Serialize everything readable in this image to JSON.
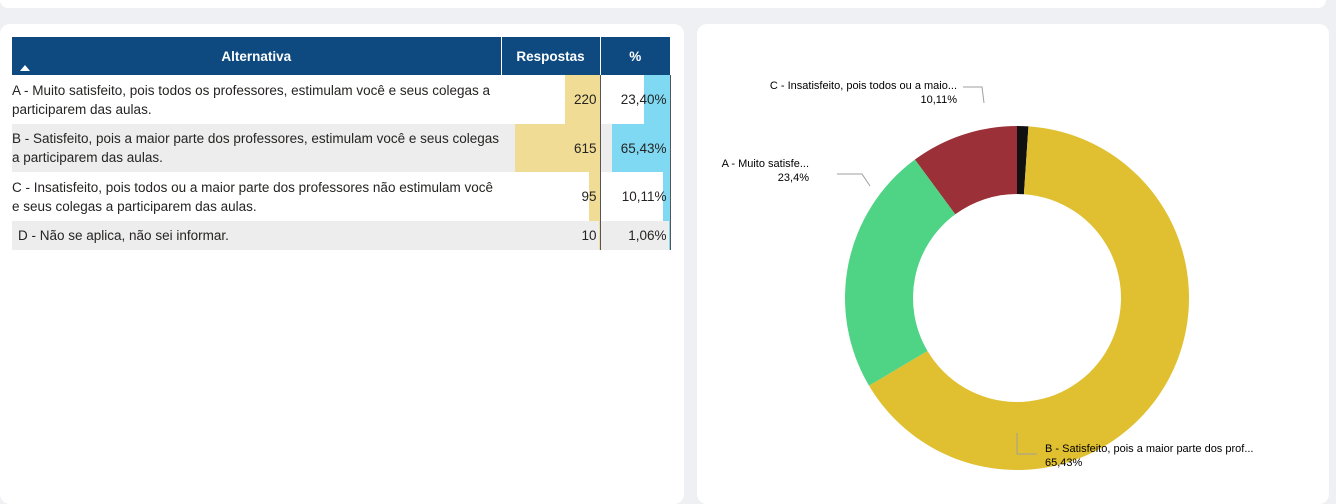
{
  "table": {
    "headers": {
      "alternativa": "Alternativa",
      "respostas": "Respostas",
      "pct": "%"
    },
    "rows": [
      {
        "alternativa": "A - Muito satisfeito, pois todos os professores, estimulam você e seus colegas a participarem das aulas.",
        "respostas": "220",
        "pct": "23,40%"
      },
      {
        "alternativa": "B - Satisfeito, pois a maior parte dos professores, estimulam você e seus colegas a participarem das aulas.",
        "respostas": "615",
        "pct": "65,43%"
      },
      {
        "alternativa": "C - Insatisfeito, pois todos ou a maior parte dos professores não estimulam você e seus colegas a participarem das aulas.",
        "respostas": "95",
        "pct": "10,11%"
      },
      {
        "alternativa": "D - Não se aplica, não sei informar.",
        "respostas": "10",
        "pct": "1,06%"
      }
    ]
  },
  "colors": {
    "header": "#0e4a80",
    "bar_respostas": "#f0dc94",
    "bar_pct": "#7fd9f3"
  },
  "chart_data": {
    "type": "pie",
    "variant": "donut",
    "categories": [
      "D - Não se aplica, não sei informar.",
      "B - Satisfeito, pois a maior parte dos prof...",
      "A - Muito satisfe...",
      "C - Insatisfeito, pois todos ou a maio..."
    ],
    "values": [
      1.06,
      65.43,
      23.4,
      10.11
    ],
    "value_labels": [
      "",
      "65,43%",
      "23,4%",
      "10,11%"
    ],
    "colors": [
      "#111111",
      "#e0c030",
      "#4fd486",
      "#9c3038"
    ]
  }
}
